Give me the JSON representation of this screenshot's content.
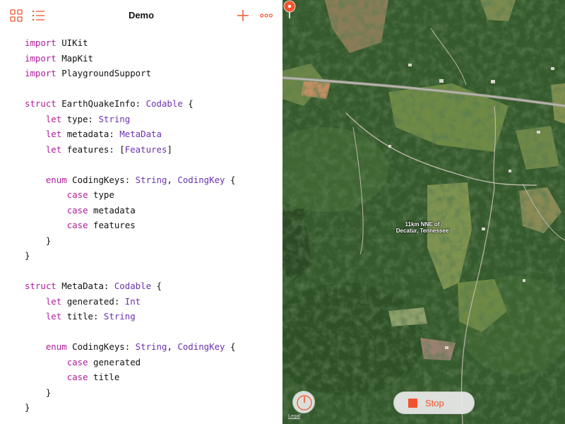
{
  "editor": {
    "title": "Demo",
    "icons": {
      "grid": "grid-icon",
      "list": "list-icon",
      "add": "plus-icon",
      "more": "more-icon"
    },
    "accent_color": "#f3532c",
    "code_lines": [
      [
        {
          "t": "import",
          "k": "kw"
        },
        {
          "t": " UIKit",
          "k": "pl"
        }
      ],
      [
        {
          "t": "import",
          "k": "kw"
        },
        {
          "t": " MapKit",
          "k": "pl"
        }
      ],
      [
        {
          "t": "import",
          "k": "kw"
        },
        {
          "t": " PlaygroundSupport",
          "k": "pl"
        }
      ],
      [],
      [
        {
          "t": "struct",
          "k": "kw"
        },
        {
          "t": " EarthQuakeInfo: ",
          "k": "pl"
        },
        {
          "t": "Codable",
          "k": "ty"
        },
        {
          "t": " {",
          "k": "pl"
        }
      ],
      [
        {
          "t": "    ",
          "k": "pl"
        },
        {
          "t": "let",
          "k": "kw"
        },
        {
          "t": " type: ",
          "k": "pl"
        },
        {
          "t": "String",
          "k": "ty"
        }
      ],
      [
        {
          "t": "    ",
          "k": "pl"
        },
        {
          "t": "let",
          "k": "kw"
        },
        {
          "t": " metadata: ",
          "k": "pl"
        },
        {
          "t": "MetaData",
          "k": "ty"
        }
      ],
      [
        {
          "t": "    ",
          "k": "pl"
        },
        {
          "t": "let",
          "k": "kw"
        },
        {
          "t": " features: [",
          "k": "pl"
        },
        {
          "t": "Features",
          "k": "ty"
        },
        {
          "t": "]",
          "k": "pl"
        }
      ],
      [],
      [
        {
          "t": "    ",
          "k": "pl"
        },
        {
          "t": "enum",
          "k": "kw"
        },
        {
          "t": " CodingKeys: ",
          "k": "pl"
        },
        {
          "t": "String",
          "k": "ty"
        },
        {
          "t": ", ",
          "k": "pl"
        },
        {
          "t": "CodingKey",
          "k": "ty"
        },
        {
          "t": " {",
          "k": "pl"
        }
      ],
      [
        {
          "t": "        ",
          "k": "pl"
        },
        {
          "t": "case",
          "k": "kw"
        },
        {
          "t": " type",
          "k": "pl"
        }
      ],
      [
        {
          "t": "        ",
          "k": "pl"
        },
        {
          "t": "case",
          "k": "kw"
        },
        {
          "t": " metadata",
          "k": "pl"
        }
      ],
      [
        {
          "t": "        ",
          "k": "pl"
        },
        {
          "t": "case",
          "k": "kw"
        },
        {
          "t": " features",
          "k": "pl"
        }
      ],
      [
        {
          "t": "    }",
          "k": "pl"
        }
      ],
      [
        {
          "t": "}",
          "k": "pl"
        }
      ],
      [],
      [
        {
          "t": "struct",
          "k": "kw"
        },
        {
          "t": " MetaData: ",
          "k": "pl"
        },
        {
          "t": "Codable",
          "k": "ty"
        },
        {
          "t": " {",
          "k": "pl"
        }
      ],
      [
        {
          "t": "    ",
          "k": "pl"
        },
        {
          "t": "let",
          "k": "kw"
        },
        {
          "t": " generated: ",
          "k": "pl"
        },
        {
          "t": "Int",
          "k": "ty"
        }
      ],
      [
        {
          "t": "    ",
          "k": "pl"
        },
        {
          "t": "let",
          "k": "kw"
        },
        {
          "t": " title: ",
          "k": "pl"
        },
        {
          "t": "String",
          "k": "ty"
        }
      ],
      [],
      [
        {
          "t": "    ",
          "k": "pl"
        },
        {
          "t": "enum",
          "k": "kw"
        },
        {
          "t": " CodingKeys: ",
          "k": "pl"
        },
        {
          "t": "String",
          "k": "ty"
        },
        {
          "t": ", ",
          "k": "pl"
        },
        {
          "t": "CodingKey",
          "k": "ty"
        },
        {
          "t": " {",
          "k": "pl"
        }
      ],
      [
        {
          "t": "        ",
          "k": "pl"
        },
        {
          "t": "case",
          "k": "kw"
        },
        {
          "t": " generated",
          "k": "pl"
        }
      ],
      [
        {
          "t": "        ",
          "k": "pl"
        },
        {
          "t": "case",
          "k": "kw"
        },
        {
          "t": " title",
          "k": "pl"
        }
      ],
      [
        {
          "t": "    }",
          "k": "pl"
        }
      ],
      [
        {
          "t": "}",
          "k": "pl"
        }
      ]
    ]
  },
  "map": {
    "pin_label_line1": "11km NNE of",
    "pin_label_line2": "Decatur, Tennessee",
    "pin_color": "#f3532c",
    "legal": "Legal",
    "compass_icon": "compass-icon",
    "stop_label": "Stop",
    "stop_icon": "stop-icon"
  }
}
